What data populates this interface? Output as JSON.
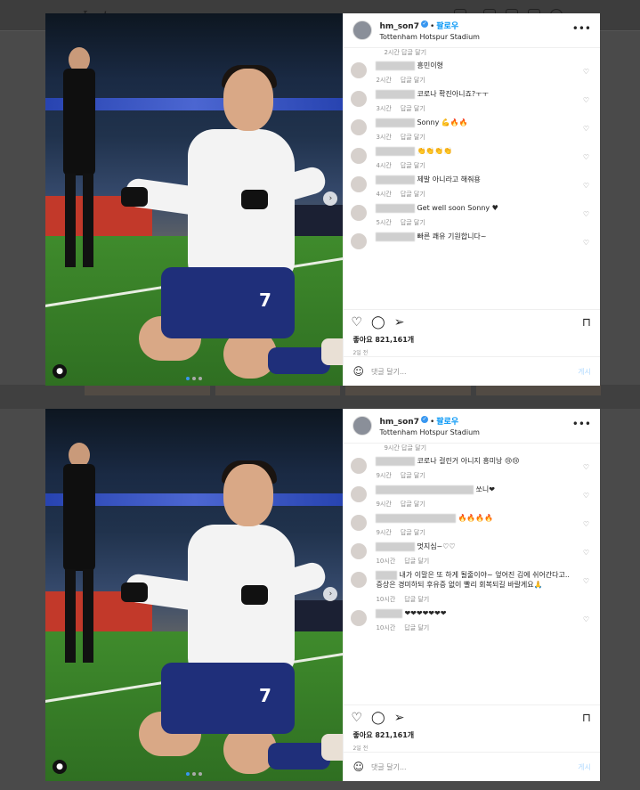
{
  "posts": [
    {
      "user": "hm_son7",
      "sep": "•",
      "follow": "팔로우",
      "location": "Tottenham Hotspur Stadium",
      "top_time": "2시간  답글 달기",
      "jersey_number": "7",
      "comments": [
        {
          "text": "흥민이형",
          "time": "2시간",
          "reply": "답글 달기"
        },
        {
          "text": "코로나 확진아니죠?ㅜㅜ",
          "time": "3시간",
          "reply": "답글 달기"
        },
        {
          "text": "Sonny 💪🔥🔥",
          "time": "3시간",
          "reply": "답글 달기"
        },
        {
          "text": "👏👏👏👏",
          "time": "4시간",
          "reply": "답글 달기"
        },
        {
          "text": "제발 아니라고 해줘용",
          "time": "4시간",
          "reply": "답글 달기"
        },
        {
          "text": "Get well soon Sonny ♥",
          "time": "5시간",
          "reply": "답글 달기"
        },
        {
          "text": "빠른 쾌유 기원합니다~",
          "time": "",
          "reply": ""
        }
      ],
      "likes": "좋아요 821,161개",
      "ago": "2일 전",
      "comment_placeholder": "댓글 달기...",
      "post_label": "게시"
    },
    {
      "user": "hm_son7",
      "sep": "•",
      "follow": "팔로우",
      "location": "Tottenham Hotspur Stadium",
      "top_time": "9시간  답글 달기",
      "jersey_number": "7",
      "comments": [
        {
          "text": "코로나 걸린거 아니지 흥미낭 😢😢",
          "time": "9시간",
          "reply": "답글 달기"
        },
        {
          "text": "쏘니❤",
          "time": "9시간",
          "reply": "답글 달기"
        },
        {
          "text": "🔥🔥🔥🔥",
          "time": "9시간",
          "reply": "답글 달기"
        },
        {
          "text": "멋지심~♡♡",
          "time": "10시간",
          "reply": "답글 달기"
        },
        {
          "text": "내가 이말은 또 하게 될줄이야~ 엎어진 김에 쉬어간다고.. 증상은 경미하되 후유증 없이 빨리 회복되길 바랄게요🙏",
          "time": "10시간",
          "reply": "답글 달기"
        },
        {
          "text": "❤❤❤❤❤❤❤",
          "time": "10시간",
          "reply": "답글 달기"
        }
      ],
      "likes": "좋아요 821,161개",
      "ago": "2일 전",
      "comment_placeholder": "댓글 달기...",
      "post_label": "게시"
    }
  ],
  "header_logo": "Instagram",
  "colors": {
    "link": "#0095f6",
    "verified": "#3897f0",
    "muted": "#8e8e8e",
    "backdrop": "#4a4a4a"
  }
}
